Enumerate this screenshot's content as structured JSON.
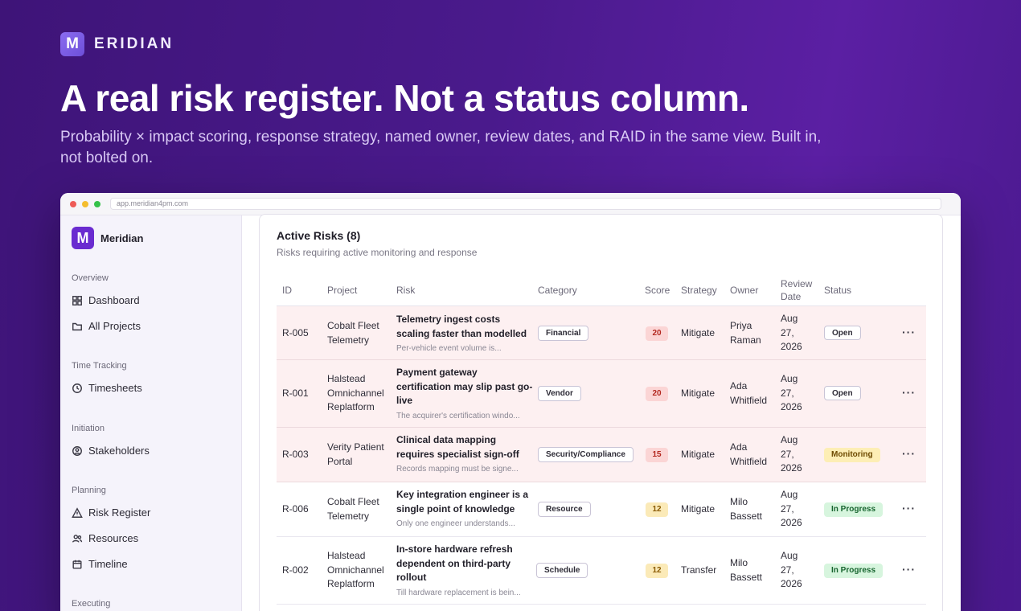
{
  "hero": {
    "brand": "ERIDIAN",
    "brand_letter": "M",
    "headline": "A real risk register. Not a status column.",
    "subhead": "Probability × impact scoring, response strategy, named owner, review dates, and RAID in the same view. Built in, not bolted on."
  },
  "browser": {
    "url": "app.meridian4pm.com"
  },
  "sidebar": {
    "brand": "Meridian",
    "brand_letter": "M",
    "sections": [
      {
        "label": "Overview",
        "items": [
          {
            "label": "Dashboard",
            "icon": "grid-icon"
          },
          {
            "label": "All Projects",
            "icon": "folder-icon"
          }
        ]
      },
      {
        "label": "Time Tracking",
        "items": [
          {
            "label": "Timesheets",
            "icon": "clock-icon"
          }
        ]
      },
      {
        "label": "Initiation",
        "items": [
          {
            "label": "Stakeholders",
            "icon": "user-circle-icon"
          }
        ]
      },
      {
        "label": "Planning",
        "items": [
          {
            "label": "Risk Register",
            "icon": "warning-icon"
          },
          {
            "label": "Resources",
            "icon": "users-icon"
          },
          {
            "label": "Timeline",
            "icon": "calendar-icon"
          }
        ]
      },
      {
        "label": "Executing",
        "items": []
      }
    ]
  },
  "risks_card": {
    "title": "Active Risks (8)",
    "subtitle": "Risks requiring active monitoring and response",
    "columns": [
      "ID",
      "Project",
      "Risk",
      "Category",
      "Score",
      "Strategy",
      "Owner",
      "Review Date",
      "Status"
    ],
    "rows": [
      {
        "id": "R-005",
        "project": "Cobalt Fleet Telemetry",
        "risk_title": "Telemetry ingest costs scaling faster than modelled",
        "risk_desc": "Per-vehicle event volume is...",
        "category": "Financial",
        "score": "20",
        "strategy": "Mitigate",
        "owner": "Priya Raman",
        "review_date": "Aug 27, 2026",
        "status": "Open"
      },
      {
        "id": "R-001",
        "project": "Halstead Omnichannel Replatform",
        "risk_title": "Payment gateway certification may slip past go-live",
        "risk_desc": "The acquirer's certification windo...",
        "category": "Vendor",
        "score": "20",
        "strategy": "Mitigate",
        "owner": "Ada Whitfield",
        "review_date": "Aug 27, 2026",
        "status": "Open"
      },
      {
        "id": "R-003",
        "project": "Verity Patient Portal",
        "risk_title": "Clinical data mapping requires specialist sign-off",
        "risk_desc": "Records mapping must be signe...",
        "category": "Security/Compliance",
        "score": "15",
        "strategy": "Mitigate",
        "owner": "Ada Whitfield",
        "review_date": "Aug 27, 2026",
        "status": "Monitoring"
      },
      {
        "id": "R-006",
        "project": "Cobalt Fleet Telemetry",
        "risk_title": "Key integration engineer is a single point of knowledge",
        "risk_desc": "Only one engineer understands...",
        "category": "Resource",
        "score": "12",
        "strategy": "Mitigate",
        "owner": "Milo Bassett",
        "review_date": "Aug 27, 2026",
        "status": "In Progress"
      },
      {
        "id": "R-002",
        "project": "Halstead Omnichannel Replatform",
        "risk_title": "In-store hardware refresh dependent on third-party rollout",
        "risk_desc": "Till hardware replacement is bein...",
        "category": "Schedule",
        "score": "12",
        "strategy": "Transfer",
        "owner": "Milo Bassett",
        "review_date": "Aug 27, 2026",
        "status": "In Progress"
      }
    ],
    "more_glyph": "···"
  },
  "colors": {
    "hero_bg": "#4a1a8c",
    "accent": "#6a2bd0",
    "high_risk_row": "#fdf0f1",
    "score_high": "#fbd5d5",
    "score_medium": "#fbeab8",
    "status_monitoring": "#fdeeb5",
    "status_in_progress": "#d7f5de"
  }
}
